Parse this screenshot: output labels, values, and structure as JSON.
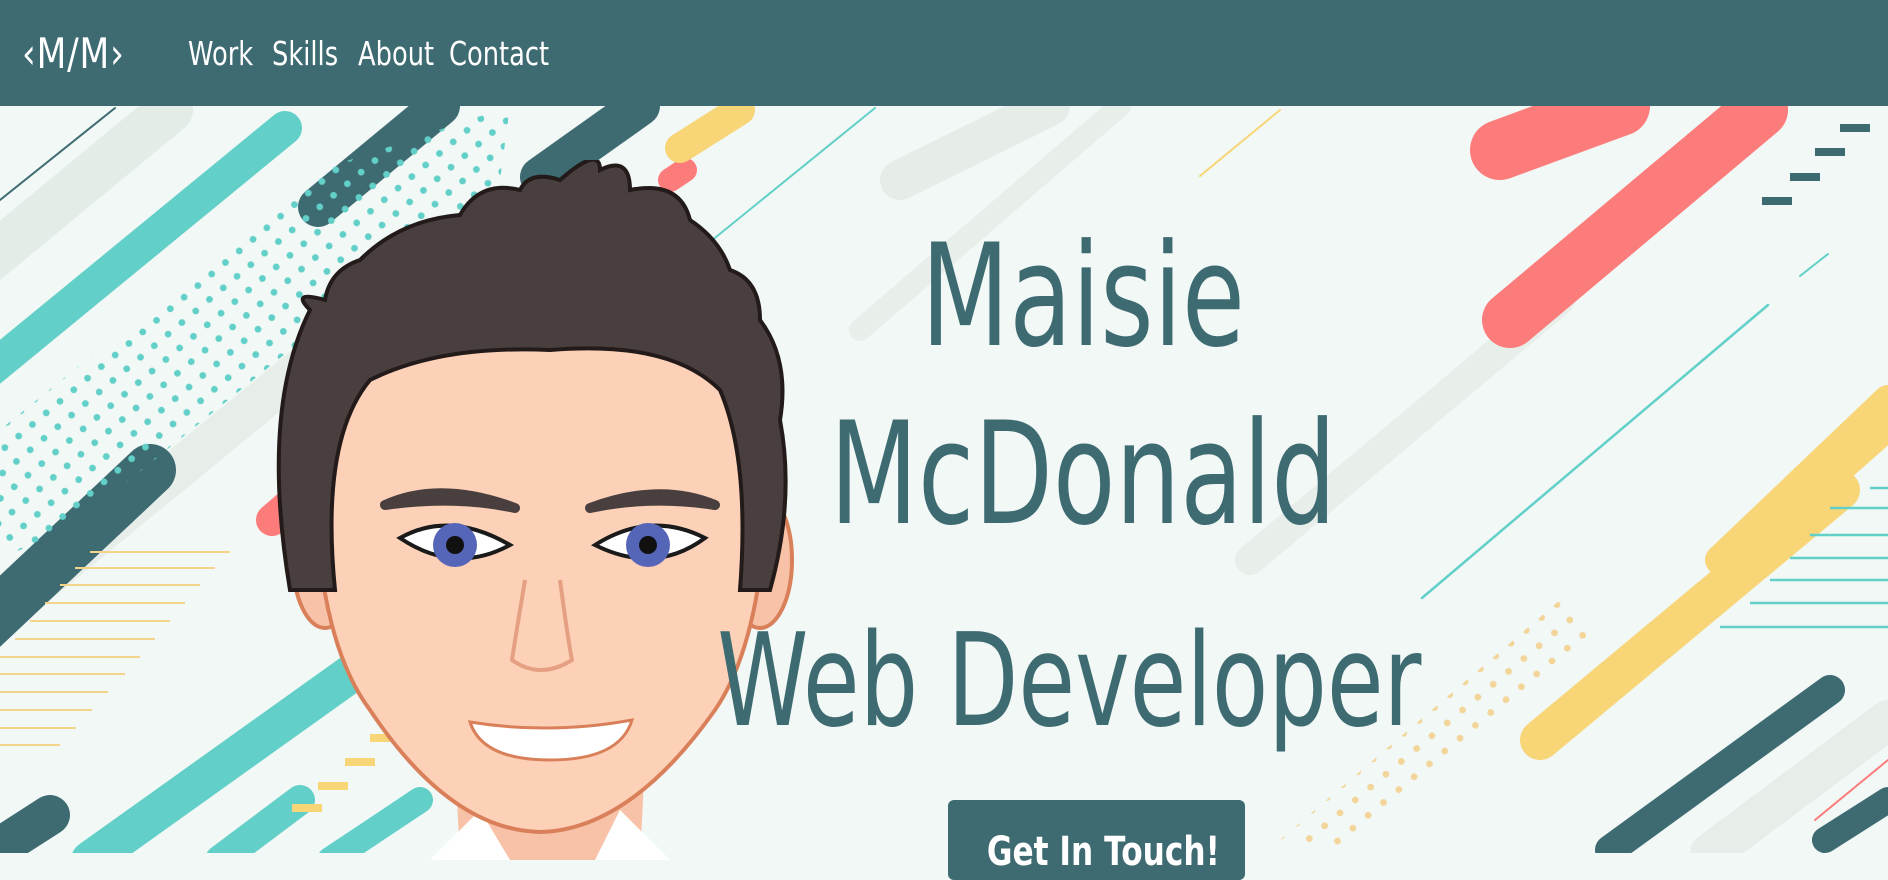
{
  "header": {
    "logo": "‹M/M›",
    "nav": [
      {
        "label": "Work"
      },
      {
        "label": "Skills"
      },
      {
        "label": "About"
      },
      {
        "label": "Contact"
      }
    ]
  },
  "hero": {
    "first_name": "Maisie",
    "last_name": "McDonald",
    "role": "Web Developer",
    "cta_label": "Get In Touch!"
  },
  "colors": {
    "primary": "#3e6b72",
    "teal": "#62d0c8",
    "coral": "#fc7c7b",
    "yellow": "#f8d576",
    "background": "#f1f8f5",
    "light_gray": "#e6eeea"
  },
  "avatar": {
    "icon": "cartoon-avatar-portrait"
  }
}
